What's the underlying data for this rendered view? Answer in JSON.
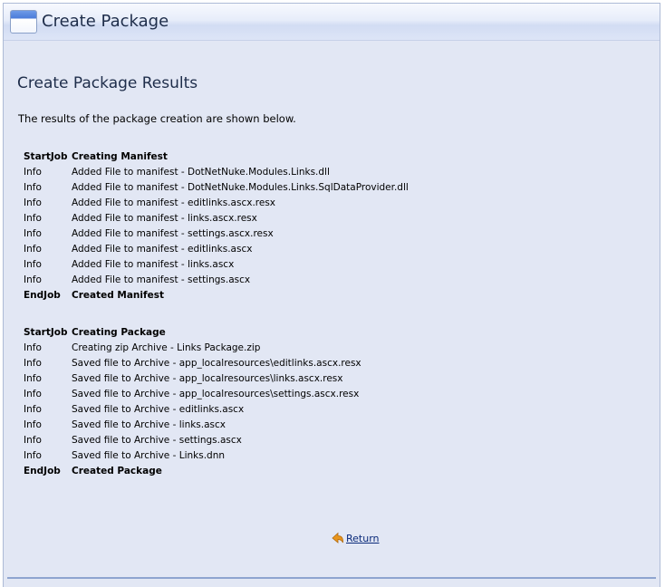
{
  "header": {
    "title": "Create Package",
    "icon": "window-icon"
  },
  "section_title": "Create Package Results",
  "intro": "The results of the package creation are shown below.",
  "log_groups": [
    {
      "rows": [
        {
          "type": "StartJob",
          "message": "Creating Manifest",
          "bold": true
        },
        {
          "type": "Info",
          "message": "Added File to manifest - DotNetNuke.Modules.Links.dll",
          "bold": false
        },
        {
          "type": "Info",
          "message": "Added File to manifest - DotNetNuke.Modules.Links.SqlDataProvider.dll",
          "bold": false
        },
        {
          "type": "Info",
          "message": "Added File to manifest - editlinks.ascx.resx",
          "bold": false
        },
        {
          "type": "Info",
          "message": "Added File to manifest - links.ascx.resx",
          "bold": false
        },
        {
          "type": "Info",
          "message": "Added File to manifest - settings.ascx.resx",
          "bold": false
        },
        {
          "type": "Info",
          "message": "Added File to manifest - editlinks.ascx",
          "bold": false
        },
        {
          "type": "Info",
          "message": "Added File to manifest - links.ascx",
          "bold": false
        },
        {
          "type": "Info",
          "message": "Added File to manifest - settings.ascx",
          "bold": false
        },
        {
          "type": "EndJob",
          "message": "Created Manifest",
          "bold": true
        }
      ]
    },
    {
      "rows": [
        {
          "type": "StartJob",
          "message": "Creating Package",
          "bold": true
        },
        {
          "type": "Info",
          "message": "Creating zip Archive - Links Package.zip",
          "bold": false
        },
        {
          "type": "Info",
          "message": "Saved file to Archive - app_localresources\\editlinks.ascx.resx",
          "bold": false
        },
        {
          "type": "Info",
          "message": "Saved file to Archive - app_localresources\\links.ascx.resx",
          "bold": false
        },
        {
          "type": "Info",
          "message": "Saved file to Archive - app_localresources\\settings.ascx.resx",
          "bold": false
        },
        {
          "type": "Info",
          "message": "Saved file to Archive - editlinks.ascx",
          "bold": false
        },
        {
          "type": "Info",
          "message": "Saved file to Archive - links.ascx",
          "bold": false
        },
        {
          "type": "Info",
          "message": "Saved file to Archive - settings.ascx",
          "bold": false
        },
        {
          "type": "Info",
          "message": "Saved file to Archive - Links.dnn",
          "bold": false
        },
        {
          "type": "EndJob",
          "message": "Created Package",
          "bold": true
        }
      ]
    }
  ],
  "return_link": {
    "label": "Return",
    "icon": "return-arrow-icon"
  },
  "colors": {
    "panel_background": "#e2e7f4",
    "title_text": "#1e2d4a",
    "link_text": "#0a2a7a",
    "arrow_icon": "#e8951c"
  }
}
